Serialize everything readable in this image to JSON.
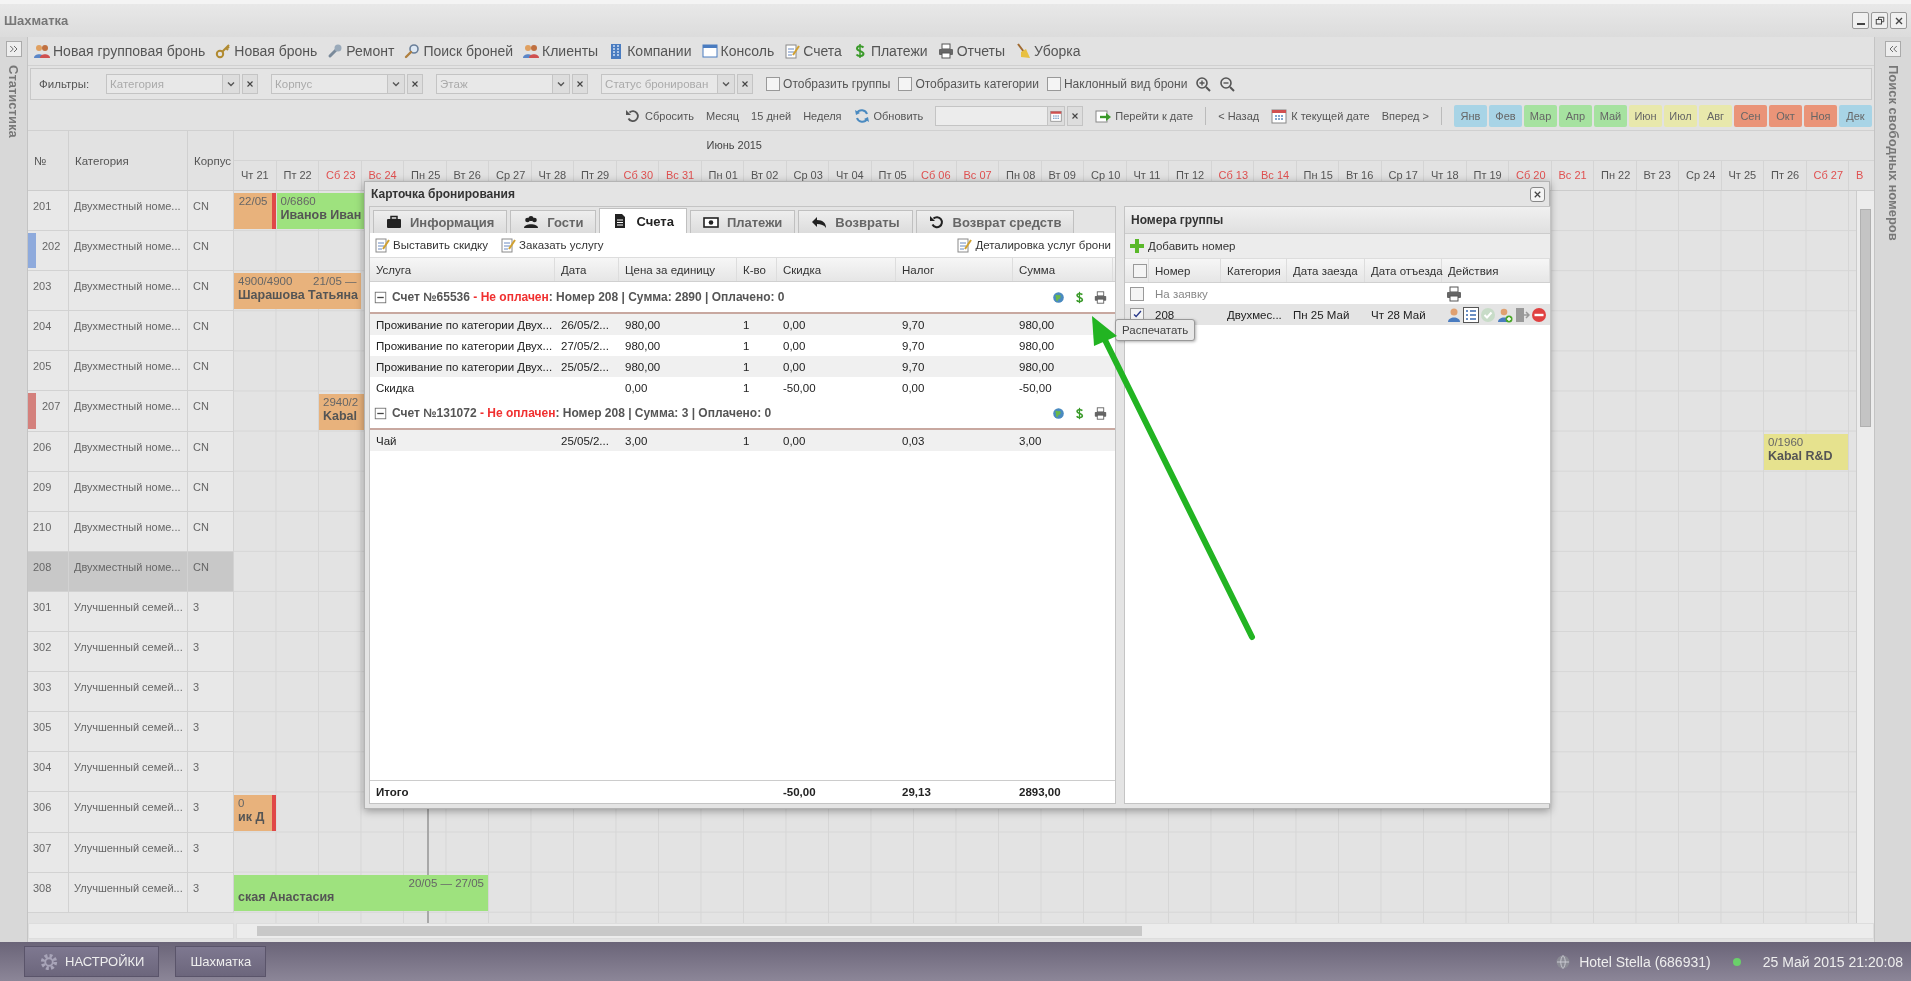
{
  "window": {
    "title": "Шахматка"
  },
  "left_sidebar": {
    "title": "Статистика"
  },
  "right_sidebar": {
    "title": "Поиск свободных номеров"
  },
  "toolbar": [
    {
      "label": "Новая групповая бронь"
    },
    {
      "label": "Новая бронь"
    },
    {
      "label": "Ремонт"
    },
    {
      "label": "Поиск броней"
    },
    {
      "label": "Клиенты"
    },
    {
      "label": "Компании"
    },
    {
      "label": "Консоль"
    },
    {
      "label": "Счета"
    },
    {
      "label": "Платежи"
    },
    {
      "label": "Отчеты"
    },
    {
      "label": "Уборка"
    }
  ],
  "filters": {
    "label": "Фильтры:",
    "combos": [
      {
        "placeholder": "Категория"
      },
      {
        "placeholder": "Корпус"
      },
      {
        "placeholder": "Этаж"
      },
      {
        "placeholder": "Статус бронирован"
      }
    ],
    "checkboxes": [
      {
        "label": "Отобразить группы",
        "checked": false
      },
      {
        "label": "Отобразить категории",
        "checked": false
      },
      {
        "label": "Наклонный вид брони",
        "checked": false
      }
    ]
  },
  "navigation": {
    "view_buttons": [
      {
        "label": "Сбросить"
      },
      {
        "label": "Месяц"
      },
      {
        "label": "15 дней"
      },
      {
        "label": "Неделя"
      },
      {
        "label": "Обновить"
      }
    ],
    "go_to_date": "Перейти к дате",
    "back": "< Назад",
    "to_today": "К текущей дате",
    "forward": "Вперед >",
    "months": [
      {
        "label": "Янв",
        "color": "#a8d4e6"
      },
      {
        "label": "Фев",
        "color": "#a8d4e6"
      },
      {
        "label": "Мар",
        "color": "#a6e2a0"
      },
      {
        "label": "Апр",
        "color": "#a6e2a0"
      },
      {
        "label": "Май",
        "color": "#a6e2a0"
      },
      {
        "label": "Июн",
        "color": "#e8e8ac"
      },
      {
        "label": "Июл",
        "color": "#e8e8ac"
      },
      {
        "label": "Авг",
        "color": "#e8e8ac"
      },
      {
        "label": "Сен",
        "color": "#ea9478"
      },
      {
        "label": "Окт",
        "color": "#ea9478"
      },
      {
        "label": "Ноя",
        "color": "#ea9478"
      },
      {
        "label": "Дек",
        "color": "#a8d4e6"
      }
    ]
  },
  "grid": {
    "columns": [
      "№",
      "Категория",
      "Корпус"
    ],
    "months": [
      {
        "label": "Июнь 2015"
      }
    ],
    "days": [
      {
        "label": "Чт 21",
        "weekend": false
      },
      {
        "label": "Пт 22",
        "weekend": false
      },
      {
        "label": "Сб 23",
        "weekend": true
      },
      {
        "label": "Вс 24",
        "weekend": true
      },
      {
        "label": "Пн 25",
        "weekend": false
      },
      {
        "label": "Вт 26",
        "weekend": false
      },
      {
        "label": "Ср 27",
        "weekend": false
      },
      {
        "label": "Чт 28",
        "weekend": false
      },
      {
        "label": "Пт 29",
        "weekend": false
      },
      {
        "label": "Сб 30",
        "weekend": true
      },
      {
        "label": "Вс 31",
        "weekend": true
      },
      {
        "label": "Пн 01",
        "weekend": false
      },
      {
        "label": "Вт 02",
        "weekend": false
      },
      {
        "label": "Ср 03",
        "weekend": false
      },
      {
        "label": "Чт 04",
        "weekend": false
      },
      {
        "label": "Пт 05",
        "weekend": false
      },
      {
        "label": "Сб 06",
        "weekend": true
      },
      {
        "label": "Вс 07",
        "weekend": true
      },
      {
        "label": "Пн 08",
        "weekend": false
      },
      {
        "label": "Вт 09",
        "weekend": false
      },
      {
        "label": "Ср 10",
        "weekend": false
      },
      {
        "label": "Чт 11",
        "weekend": false
      },
      {
        "label": "Пт 12",
        "weekend": false
      },
      {
        "label": "Сб 13",
        "weekend": true
      },
      {
        "label": "Вс 14",
        "weekend": true
      },
      {
        "label": "Пн 15",
        "weekend": false
      },
      {
        "label": "Вт 16",
        "weekend": false
      },
      {
        "label": "Ср 17",
        "weekend": false
      },
      {
        "label": "Чт 18",
        "weekend": false
      },
      {
        "label": "Пт 19",
        "weekend": false
      },
      {
        "label": "Сб 20",
        "weekend": true
      },
      {
        "label": "Вс 21",
        "weekend": true
      },
      {
        "label": "Пн 22",
        "weekend": false
      },
      {
        "label": "Вт 23",
        "weekend": false
      },
      {
        "label": "Ср 24",
        "weekend": false
      },
      {
        "label": "Чт 25",
        "weekend": false
      },
      {
        "label": "Пт 26",
        "weekend": false
      },
      {
        "label": "Сб 27",
        "weekend": true
      },
      {
        "label": "В",
        "weekend": true
      }
    ],
    "rooms": [
      {
        "number": "201",
        "category": "Двухместный номе...",
        "building": "CN",
        "selected": false,
        "bookings": [
          {
            "color": "#e8b27c",
            "dates": "22/05",
            "marked": true
          },
          {
            "color": "#9ee27e",
            "amount": "0/6860",
            "guest": "Иванов Иван"
          }
        ]
      },
      {
        "number": "202",
        "category": "Двухместный номе...",
        "building": "CN",
        "selected": false,
        "color": "#8eaadc"
      },
      {
        "number": "203",
        "category": "Двухместный номе...",
        "building": "CN",
        "selected": false,
        "bookings": [
          {
            "color": "#e8b27c",
            "amount": "4900/4900",
            "dates": "21/05 —",
            "guest": "Шарашова Татьяна",
            "marked": false
          }
        ]
      },
      {
        "number": "204",
        "category": "Двухместный номе...",
        "building": "CN",
        "selected": false
      },
      {
        "number": "205",
        "category": "Двухместный номе...",
        "building": "CN",
        "selected": false
      },
      {
        "number": "207",
        "category": "Двухместный номе...",
        "building": "CN",
        "selected": false,
        "color": "#d4807c",
        "bookings": [
          {
            "color": "#e8b27c",
            "amount": "2940/2",
            "guest": "Kabal"
          }
        ]
      },
      {
        "number": "206",
        "category": "Двухместный номе...",
        "building": "CN",
        "selected": false,
        "bookings": [
          {
            "color": "#e6e28e",
            "amount": "0/1960",
            "guest": "Kabal R&D",
            "marked": false
          }
        ]
      },
      {
        "number": "209",
        "category": "Двухместный номе...",
        "building": "CN",
        "selected": false
      },
      {
        "number": "210",
        "category": "Двухместный номе...",
        "building": "CN",
        "selected": false
      },
      {
        "number": "208",
        "category": "Двухместный номе...",
        "building": "CN",
        "selected": true
      },
      {
        "number": "301",
        "category": "Улучшенный семей...",
        "building": "3",
        "selected": false
      },
      {
        "number": "302",
        "category": "Улучшенный семей...",
        "building": "3",
        "selected": false
      },
      {
        "number": "303",
        "category": "Улучшенный семей...",
        "building": "3",
        "selected": false
      },
      {
        "number": "305",
        "category": "Улучшенный семей...",
        "building": "3",
        "selected": false
      },
      {
        "number": "304",
        "category": "Улучшенный семей...",
        "building": "3",
        "selected": false
      },
      {
        "number": "306",
        "category": "Улучшенный семей...",
        "building": "3",
        "selected": false,
        "bookings": [
          {
            "color": "#e8b27c",
            "amount": "0",
            "guest": "ик Д",
            "marked": true
          }
        ]
      },
      {
        "number": "307",
        "category": "Улучшенный семей...",
        "building": "3",
        "selected": false
      },
      {
        "number": "308",
        "category": "Улучшенный семей...",
        "building": "3",
        "selected": false,
        "bookings": [
          {
            "color": "#9ee27e",
            "dates": "20/05 — 27/05",
            "guest": "ская Анастасия",
            "marked": false
          }
        ]
      }
    ]
  },
  "booking_card": {
    "title": "Карточка бронирования",
    "tabs": [
      {
        "label": "Информация",
        "selected": false
      },
      {
        "label": "Гости",
        "selected": false
      },
      {
        "label": "Счета",
        "selected": true
      },
      {
        "label": "Платежи",
        "selected": false
      },
      {
        "label": "Возвраты",
        "selected": false
      },
      {
        "label": "Возврат средств",
        "selected": false
      }
    ],
    "toolbar": [
      "Выставить скидку",
      "Заказать услугу"
    ],
    "details_button": "Деталировка услуг брони",
    "columns": [
      "Услуга",
      "Дата",
      "Цена за единицу",
      "К-во",
      "Скидка",
      "Налог",
      "Сумма"
    ],
    "invoices": [
      {
        "title": "Счет №65536",
        "status": "- Не оплачен",
        "summary": ": Номер 208 | Сумма: 2890 | Оплачено: 0",
        "paid": false,
        "expanded": true,
        "rows": [
          {
            "service": "Проживание по категории Двух...",
            "date": "26/05/2...",
            "price": "980,00",
            "qty": "1",
            "discount": "0,00",
            "tax": "9,70",
            "sum": "980,00"
          },
          {
            "service": "Проживание по категории Двух...",
            "date": "27/05/2...",
            "price": "980,00",
            "qty": "1",
            "discount": "0,00",
            "tax": "9,70",
            "sum": "980,00"
          },
          {
            "service": "Проживание по категории Двух...",
            "date": "25/05/2...",
            "price": "980,00",
            "qty": "1",
            "discount": "0,00",
            "tax": "9,70",
            "sum": "980,00"
          },
          {
            "service": "Скидка",
            "price": "0,00",
            "qty": "1",
            "discount": "-50,00",
            "tax": "0,00",
            "sum": "-50,00"
          }
        ]
      },
      {
        "title": "Счет №131072",
        "status": "- Не оплачен",
        "summary": ": Номер 208 | Сумма: 3 | Оплачено: 0",
        "paid": false,
        "expanded": true,
        "rows": [
          {
            "service": "Чай",
            "date": "25/05/2...",
            "price": "3,00",
            "qty": "1",
            "discount": "0,00",
            "tax": "0,03",
            "sum": "3,00"
          }
        ]
      }
    ],
    "totals": {
      "label": "Итого",
      "discount": "-50,00",
      "tax": "29,13",
      "sum": "2893,00"
    }
  },
  "group_rooms": {
    "title": "Номера группы",
    "add_button": "Добавить номер",
    "all_checked": false,
    "columns": [
      "Номер",
      "Категория",
      "Дата заезда",
      "Дата отъезда",
      "Действия"
    ],
    "rows": [
      {
        "kind": "request",
        "label": "На заявку",
        "checked": false,
        "selected": false
      },
      {
        "kind": "room",
        "number": "208",
        "category": "Двухмес...",
        "arrival": "Пн 25 Май",
        "departure": "Чт 28 Май",
        "checked": true,
        "selected": true
      }
    ]
  },
  "tooltip": {
    "text": "Распечатать"
  },
  "taskbar": {
    "buttons": [
      {
        "label": "НАСТРОЙКИ"
      },
      {
        "label": "Шахматка"
      }
    ],
    "hotel": "Hotel Stella (686931)",
    "datetime": "25 Май 2015 21:20:08"
  }
}
